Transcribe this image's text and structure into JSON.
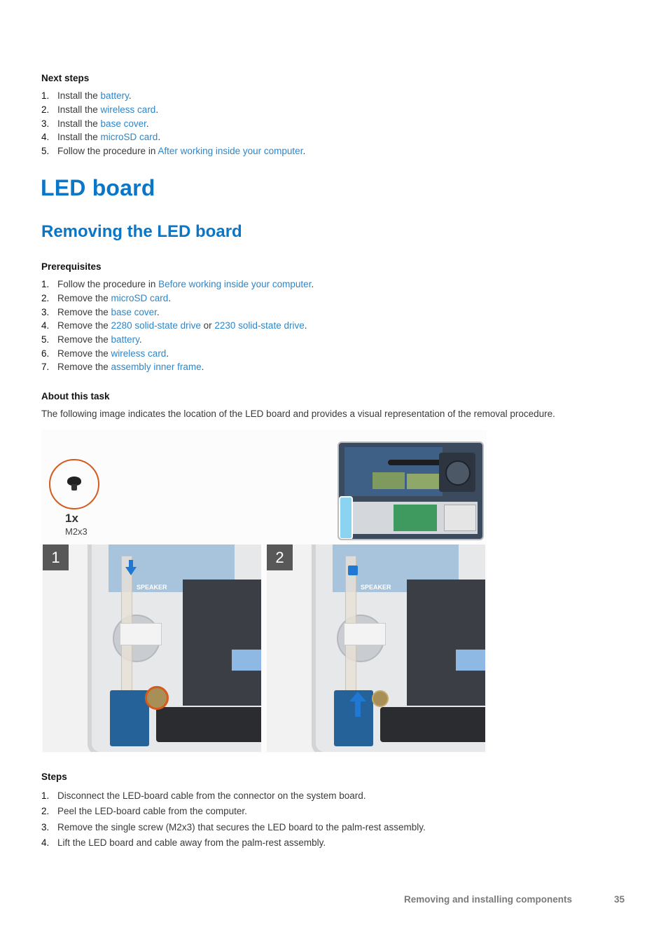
{
  "next_steps": {
    "heading": "Next steps",
    "items": [
      {
        "num": "1.",
        "prefix": "Install the ",
        "link": "battery",
        "suffix": "."
      },
      {
        "num": "2.",
        "prefix": "Install the ",
        "link": "wireless card",
        "suffix": "."
      },
      {
        "num": "3.",
        "prefix": "Install the ",
        "link": "base cover",
        "suffix": "."
      },
      {
        "num": "4.",
        "prefix": "Install the ",
        "link": "microSD card",
        "suffix": "."
      },
      {
        "num": "5.",
        "prefix": "Follow the procedure in ",
        "link": "After working inside your computer",
        "suffix": "."
      }
    ]
  },
  "section_title": "LED board",
  "subsection_title": "Removing the LED board",
  "prerequisites": {
    "heading": "Prerequisites",
    "items": [
      {
        "num": "1.",
        "prefix": "Follow the procedure in ",
        "link": "Before working inside your computer",
        "middle": "",
        "link2": "",
        "suffix": "."
      },
      {
        "num": "2.",
        "prefix": "Remove the ",
        "link": "microSD card",
        "middle": "",
        "link2": "",
        "suffix": "."
      },
      {
        "num": "3.",
        "prefix": "Remove the ",
        "link": "base cover",
        "middle": "",
        "link2": "",
        "suffix": "."
      },
      {
        "num": "4.",
        "prefix": "Remove the ",
        "link": "2280 solid-state drive",
        "middle": " or ",
        "link2": "2230 solid-state drive",
        "suffix": "."
      },
      {
        "num": "5.",
        "prefix": "Remove the ",
        "link": "battery",
        "middle": "",
        "link2": "",
        "suffix": "."
      },
      {
        "num": "6.",
        "prefix": "Remove the ",
        "link": "wireless card",
        "middle": "",
        "link2": "",
        "suffix": "."
      },
      {
        "num": "7.",
        "prefix": "Remove the ",
        "link": "assembly inner frame",
        "middle": "",
        "link2": "",
        "suffix": "."
      }
    ]
  },
  "about": {
    "heading": "About this task",
    "text": "The following image indicates the location of the LED board and provides a visual representation of the removal procedure."
  },
  "figure": {
    "screw_qty": "1x",
    "screw_size": "M2x3",
    "panel1_num": "1",
    "panel2_num": "2",
    "speaker_label": "SPEAKER"
  },
  "steps": {
    "heading": "Steps",
    "items": [
      {
        "num": "1.",
        "text": "Disconnect the LED-board cable from the connector on the system board."
      },
      {
        "num": "2.",
        "text": "Peel the LED-board cable from the computer."
      },
      {
        "num": "3.",
        "text": "Remove the single screw (M2x3) that secures the LED board to the palm-rest assembly."
      },
      {
        "num": "4.",
        "text": "Lift the LED board and cable away from the palm-rest assembly."
      }
    ]
  },
  "footer": {
    "section": "Removing and installing components",
    "page": "35"
  }
}
